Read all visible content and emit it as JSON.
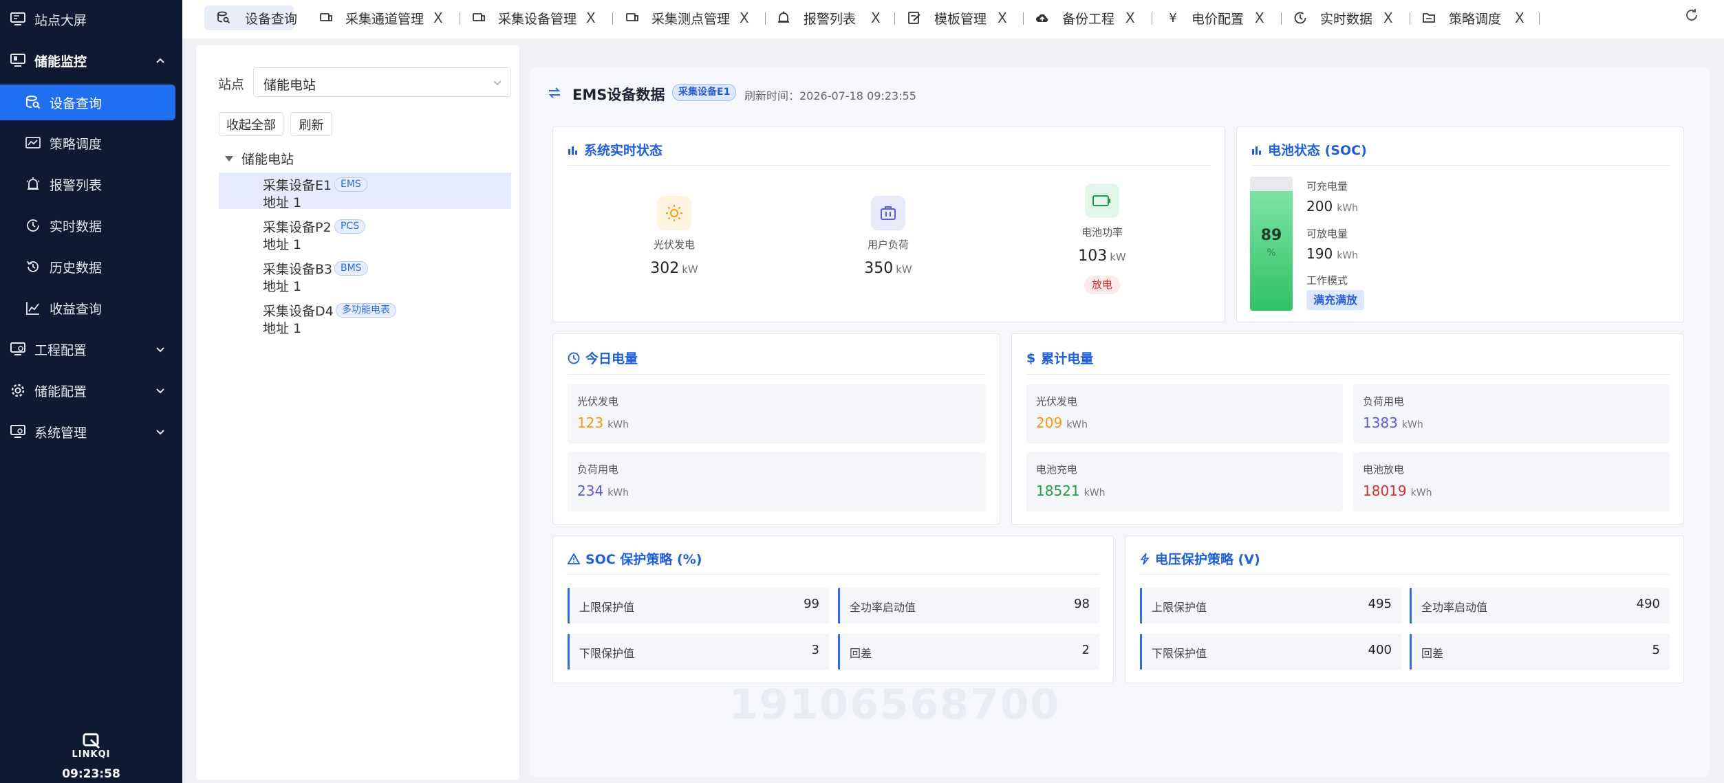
{
  "sidebar": {
    "items": [
      {
        "label": "站点大屏"
      },
      {
        "label": "储能监控"
      },
      {
        "label": "设备查询"
      },
      {
        "label": "策略调度"
      },
      {
        "label": "报警列表"
      },
      {
        "label": "实时数据"
      },
      {
        "label": "历史数据"
      },
      {
        "label": "收益查询"
      },
      {
        "label": "工程配置"
      },
      {
        "label": "储能配置"
      },
      {
        "label": "系统管理"
      }
    ],
    "logo_text": "LINKQI",
    "clock": "09:23:58"
  },
  "tabs": [
    {
      "label": "设备查询"
    },
    {
      "label": "采集通道管理"
    },
    {
      "label": "采集设备管理"
    },
    {
      "label": "采集测点管理"
    },
    {
      "label": "报警列表"
    },
    {
      "label": "模板管理"
    },
    {
      "label": "备份工程"
    },
    {
      "label": "电价配置"
    },
    {
      "label": "实时数据"
    },
    {
      "label": "策略调度"
    }
  ],
  "tab_close": "X",
  "left": {
    "station_label": "站点",
    "station_value": "储能电站",
    "collapse_btn": "收起全部",
    "refresh_btn": "刷新",
    "tree_root": "储能电站",
    "nodes": [
      {
        "name": "采集设备E1",
        "badge": "EMS",
        "addr": "地址 1"
      },
      {
        "name": "采集设备P2",
        "badge": "PCS",
        "addr": "地址 1"
      },
      {
        "name": "采集设备B3",
        "badge": "BMS",
        "addr": "地址 1"
      },
      {
        "name": "采集设备D4",
        "badge": "多功能电表",
        "addr": "地址 1"
      }
    ]
  },
  "header": {
    "title": "EMS设备数据",
    "device_badge": "采集设备E1",
    "refresh_time": "刷新时间：2026-07-18 09:23:55"
  },
  "realtime": {
    "title": "系统实时状态",
    "pv": {
      "label": "光伏发电",
      "value": "302",
      "unit": "kW"
    },
    "load": {
      "label": "用户负荷",
      "value": "350",
      "unit": "kW"
    },
    "battery": {
      "label": "电池功率",
      "value": "103",
      "unit": "kW",
      "state": "放电"
    }
  },
  "soc": {
    "title": "电池状态 (SOC)",
    "value": 89,
    "value_text": "89",
    "pct": "%",
    "chargeable_label": "可充电量",
    "chargeable_value": "200",
    "dischargeable_label": "可放电量",
    "dischargeable_value": "190",
    "unit": "kWh",
    "mode_label": "工作模式",
    "mode_value": "满充满放"
  },
  "today": {
    "title": "今日电量",
    "pv_label": "光伏发电",
    "pv_value": "123",
    "load_label": "负荷用电",
    "load_value": "234",
    "unit": "kWh"
  },
  "total": {
    "title": "累计电量",
    "pv_label": "光伏发电",
    "pv_value": "209",
    "load_label": "负荷用电",
    "load_value": "1383",
    "charge_label": "电池充电",
    "charge_value": "18521",
    "discharge_label": "电池放电",
    "discharge_value": "18019",
    "unit": "kWh"
  },
  "soc_protect": {
    "title": "SOC 保护策略 (%)",
    "upper_label": "上限保护值",
    "upper_value": "99",
    "full_label": "全功率启动值",
    "full_value": "98",
    "lower_label": "下限保护值",
    "lower_value": "3",
    "diff_label": "回差",
    "diff_value": "2"
  },
  "volt_protect": {
    "title": "电压保护策略 (V)",
    "upper_label": "上限保护值",
    "upper_value": "495",
    "full_label": "全功率启动值",
    "full_value": "490",
    "lower_label": "下限保护值",
    "lower_value": "400",
    "diff_label": "回差",
    "diff_value": "5"
  },
  "watermark": "19106568700",
  "colors": {
    "sidebar_bg": "#0e1a32",
    "accent": "#1f6ff0",
    "orange": "#f39c12",
    "purple": "#5b5bd6",
    "green": "#1e9e4a",
    "red": "#d0312d"
  }
}
